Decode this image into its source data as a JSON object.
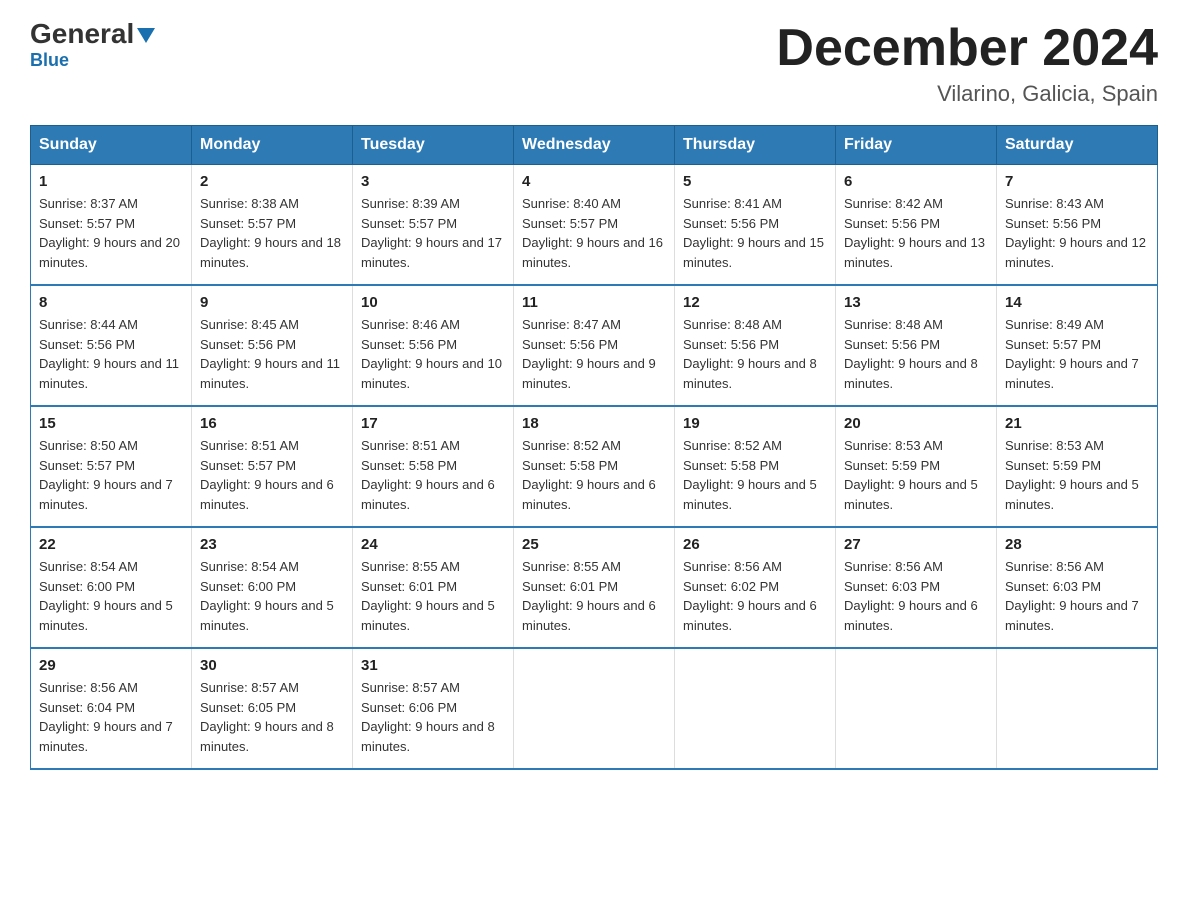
{
  "header": {
    "logo_general": "General",
    "logo_blue": "Blue",
    "month_title": "December 2024",
    "location": "Vilarino, Galicia, Spain"
  },
  "weekdays": [
    "Sunday",
    "Monday",
    "Tuesday",
    "Wednesday",
    "Thursday",
    "Friday",
    "Saturday"
  ],
  "weeks": [
    [
      {
        "day": "1",
        "sunrise": "Sunrise: 8:37 AM",
        "sunset": "Sunset: 5:57 PM",
        "daylight": "Daylight: 9 hours and 20 minutes."
      },
      {
        "day": "2",
        "sunrise": "Sunrise: 8:38 AM",
        "sunset": "Sunset: 5:57 PM",
        "daylight": "Daylight: 9 hours and 18 minutes."
      },
      {
        "day": "3",
        "sunrise": "Sunrise: 8:39 AM",
        "sunset": "Sunset: 5:57 PM",
        "daylight": "Daylight: 9 hours and 17 minutes."
      },
      {
        "day": "4",
        "sunrise": "Sunrise: 8:40 AM",
        "sunset": "Sunset: 5:57 PM",
        "daylight": "Daylight: 9 hours and 16 minutes."
      },
      {
        "day": "5",
        "sunrise": "Sunrise: 8:41 AM",
        "sunset": "Sunset: 5:56 PM",
        "daylight": "Daylight: 9 hours and 15 minutes."
      },
      {
        "day": "6",
        "sunrise": "Sunrise: 8:42 AM",
        "sunset": "Sunset: 5:56 PM",
        "daylight": "Daylight: 9 hours and 13 minutes."
      },
      {
        "day": "7",
        "sunrise": "Sunrise: 8:43 AM",
        "sunset": "Sunset: 5:56 PM",
        "daylight": "Daylight: 9 hours and 12 minutes."
      }
    ],
    [
      {
        "day": "8",
        "sunrise": "Sunrise: 8:44 AM",
        "sunset": "Sunset: 5:56 PM",
        "daylight": "Daylight: 9 hours and 11 minutes."
      },
      {
        "day": "9",
        "sunrise": "Sunrise: 8:45 AM",
        "sunset": "Sunset: 5:56 PM",
        "daylight": "Daylight: 9 hours and 11 minutes."
      },
      {
        "day": "10",
        "sunrise": "Sunrise: 8:46 AM",
        "sunset": "Sunset: 5:56 PM",
        "daylight": "Daylight: 9 hours and 10 minutes."
      },
      {
        "day": "11",
        "sunrise": "Sunrise: 8:47 AM",
        "sunset": "Sunset: 5:56 PM",
        "daylight": "Daylight: 9 hours and 9 minutes."
      },
      {
        "day": "12",
        "sunrise": "Sunrise: 8:48 AM",
        "sunset": "Sunset: 5:56 PM",
        "daylight": "Daylight: 9 hours and 8 minutes."
      },
      {
        "day": "13",
        "sunrise": "Sunrise: 8:48 AM",
        "sunset": "Sunset: 5:56 PM",
        "daylight": "Daylight: 9 hours and 8 minutes."
      },
      {
        "day": "14",
        "sunrise": "Sunrise: 8:49 AM",
        "sunset": "Sunset: 5:57 PM",
        "daylight": "Daylight: 9 hours and 7 minutes."
      }
    ],
    [
      {
        "day": "15",
        "sunrise": "Sunrise: 8:50 AM",
        "sunset": "Sunset: 5:57 PM",
        "daylight": "Daylight: 9 hours and 7 minutes."
      },
      {
        "day": "16",
        "sunrise": "Sunrise: 8:51 AM",
        "sunset": "Sunset: 5:57 PM",
        "daylight": "Daylight: 9 hours and 6 minutes."
      },
      {
        "day": "17",
        "sunrise": "Sunrise: 8:51 AM",
        "sunset": "Sunset: 5:58 PM",
        "daylight": "Daylight: 9 hours and 6 minutes."
      },
      {
        "day": "18",
        "sunrise": "Sunrise: 8:52 AM",
        "sunset": "Sunset: 5:58 PM",
        "daylight": "Daylight: 9 hours and 6 minutes."
      },
      {
        "day": "19",
        "sunrise": "Sunrise: 8:52 AM",
        "sunset": "Sunset: 5:58 PM",
        "daylight": "Daylight: 9 hours and 5 minutes."
      },
      {
        "day": "20",
        "sunrise": "Sunrise: 8:53 AM",
        "sunset": "Sunset: 5:59 PM",
        "daylight": "Daylight: 9 hours and 5 minutes."
      },
      {
        "day": "21",
        "sunrise": "Sunrise: 8:53 AM",
        "sunset": "Sunset: 5:59 PM",
        "daylight": "Daylight: 9 hours and 5 minutes."
      }
    ],
    [
      {
        "day": "22",
        "sunrise": "Sunrise: 8:54 AM",
        "sunset": "Sunset: 6:00 PM",
        "daylight": "Daylight: 9 hours and 5 minutes."
      },
      {
        "day": "23",
        "sunrise": "Sunrise: 8:54 AM",
        "sunset": "Sunset: 6:00 PM",
        "daylight": "Daylight: 9 hours and 5 minutes."
      },
      {
        "day": "24",
        "sunrise": "Sunrise: 8:55 AM",
        "sunset": "Sunset: 6:01 PM",
        "daylight": "Daylight: 9 hours and 5 minutes."
      },
      {
        "day": "25",
        "sunrise": "Sunrise: 8:55 AM",
        "sunset": "Sunset: 6:01 PM",
        "daylight": "Daylight: 9 hours and 6 minutes."
      },
      {
        "day": "26",
        "sunrise": "Sunrise: 8:56 AM",
        "sunset": "Sunset: 6:02 PM",
        "daylight": "Daylight: 9 hours and 6 minutes."
      },
      {
        "day": "27",
        "sunrise": "Sunrise: 8:56 AM",
        "sunset": "Sunset: 6:03 PM",
        "daylight": "Daylight: 9 hours and 6 minutes."
      },
      {
        "day": "28",
        "sunrise": "Sunrise: 8:56 AM",
        "sunset": "Sunset: 6:03 PM",
        "daylight": "Daylight: 9 hours and 7 minutes."
      }
    ],
    [
      {
        "day": "29",
        "sunrise": "Sunrise: 8:56 AM",
        "sunset": "Sunset: 6:04 PM",
        "daylight": "Daylight: 9 hours and 7 minutes."
      },
      {
        "day": "30",
        "sunrise": "Sunrise: 8:57 AM",
        "sunset": "Sunset: 6:05 PM",
        "daylight": "Daylight: 9 hours and 8 minutes."
      },
      {
        "day": "31",
        "sunrise": "Sunrise: 8:57 AM",
        "sunset": "Sunset: 6:06 PM",
        "daylight": "Daylight: 9 hours and 8 minutes."
      },
      null,
      null,
      null,
      null
    ]
  ]
}
